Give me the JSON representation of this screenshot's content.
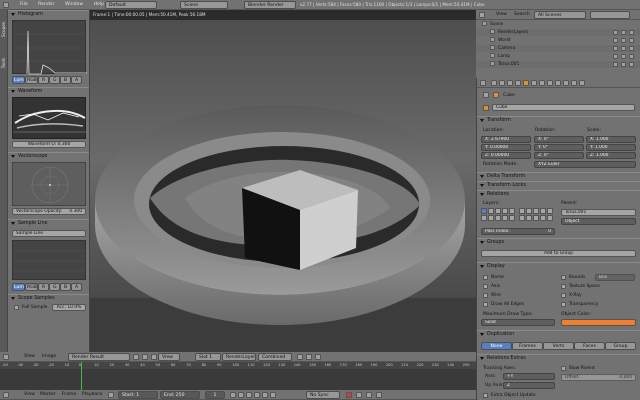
{
  "info_bar": {
    "menus": [
      "File",
      "Render",
      "Window",
      "Help"
    ],
    "layout": "Default",
    "scene": "Scene",
    "engine": "Blender Render",
    "stats": "v2.77 | Verts:584 | Faces:580 | Tris:1160 | Objects:1/3 | Lamps:0/1 | Mem:50.41M | Cube"
  },
  "left_panel": {
    "vtabs": [
      "Scopes",
      "Tools"
    ],
    "histogram": {
      "title": "Histogram",
      "modes": [
        "Luma",
        "RGB",
        "R",
        "G",
        "B",
        "A"
      ]
    },
    "waveform": {
      "title": "Waveform",
      "opacity": "Waveform O: 0.300"
    },
    "vectorscope": {
      "title": "Vectorscope",
      "opacity": "Vectorscope Opacity:",
      "opacity_value": "0.300"
    },
    "sample_line": {
      "title": "Sample Line",
      "button": "Sample Line",
      "modes": [
        "Luma",
        "RGB",
        "R",
        "G",
        "B",
        "A"
      ]
    },
    "scope_samples": {
      "title": "Scope Samples",
      "full": "Full Sample",
      "acc": "Acc: 10.0%"
    }
  },
  "viewport": {
    "info": "Frame:1 | Time:00:00.05 | Mem:50.41M, Peak 56.18M"
  },
  "image_header": {
    "menus": [
      "View",
      "Image"
    ],
    "image_name": "Render Result",
    "view": "View",
    "slot": "Slot 1",
    "layer": "RenderLayer",
    "pass": "Combined"
  },
  "timeline": {
    "ticks": [
      "-50",
      "-40",
      "-30",
      "-20",
      "-10",
      "0",
      "10",
      "20",
      "30",
      "40",
      "50",
      "60",
      "70",
      "80",
      "90",
      "100",
      "110",
      "120",
      "130",
      "140",
      "150",
      "160",
      "170",
      "180",
      "190",
      "200",
      "210",
      "220",
      "230",
      "240",
      "250"
    ],
    "menus": [
      "View",
      "Marker",
      "Frame",
      "Playback"
    ],
    "start": "Start:",
    "start_val": "1",
    "end": "End:",
    "end_val": "250",
    "current": "1",
    "sync": "No Sync"
  },
  "outliner": {
    "menus": [
      "View",
      "Search"
    ],
    "scenes": "All Scenes",
    "items": [
      {
        "name": "Scene",
        "indent": 0
      },
      {
        "name": "RenderLayers",
        "indent": 1
      },
      {
        "name": "World",
        "indent": 1
      },
      {
        "name": "Camera",
        "indent": 1
      },
      {
        "name": "Lamp",
        "indent": 1
      },
      {
        "name": "Torus.001",
        "indent": 1
      }
    ]
  },
  "properties": {
    "object_name": "Cube",
    "transform": {
      "title": "Transform",
      "location": "Location:",
      "rotation": "Rotation:",
      "scale": "Scale:",
      "loc": [
        "X: 2.67900",
        "Y: 0.00000",
        "Z: 0.00000"
      ],
      "rot": [
        "X: 0°",
        "Y: 0°",
        "Z: 0°"
      ],
      "scl": [
        "X: 1.000",
        "Y: 1.000",
        "Z: 1.000"
      ],
      "rotation_mode": "Rotation Mode:",
      "rotation_mode_val": "XYZ Euler"
    },
    "delta_transform": "Delta Transform",
    "transform_locks": "Transform Locks",
    "relations": {
      "title": "Relations",
      "layers": "Layers:",
      "parent": "Parent:",
      "parent_val": "Torus.001",
      "parent_type": "Object",
      "pass_index": "Pass Index:",
      "pass_index_val": "0"
    },
    "groups": {
      "title": "Groups",
      "add": "Add to Group"
    },
    "display": {
      "title": "Display",
      "left": [
        "Name",
        "Axis",
        "Wire",
        "Draw All Edges"
      ],
      "right": [
        "Bounds",
        "Texture Space",
        "X-Ray",
        "Transparency"
      ],
      "bounds_type": "Box",
      "max_draw": "Maximum Draw Type:",
      "max_draw_val": "Solid",
      "obj_color": "Object Color:",
      "obj_color_hex": "#f08030"
    },
    "duplication": {
      "title": "Duplication",
      "modes": [
        "None",
        "Frames",
        "Verts",
        "Faces",
        "Group"
      ]
    },
    "relations_extras": {
      "title": "Relations Extras",
      "tracking": "Tracking Axes:",
      "axis": "Axis:",
      "axis_val": "+Y",
      "up": "Up Axis:",
      "up_val": "Z",
      "slow_parent": "Slow Parent",
      "offset": "Offset:",
      "offset_val": "0.000",
      "extra_update": "Extra Object Update"
    }
  }
}
